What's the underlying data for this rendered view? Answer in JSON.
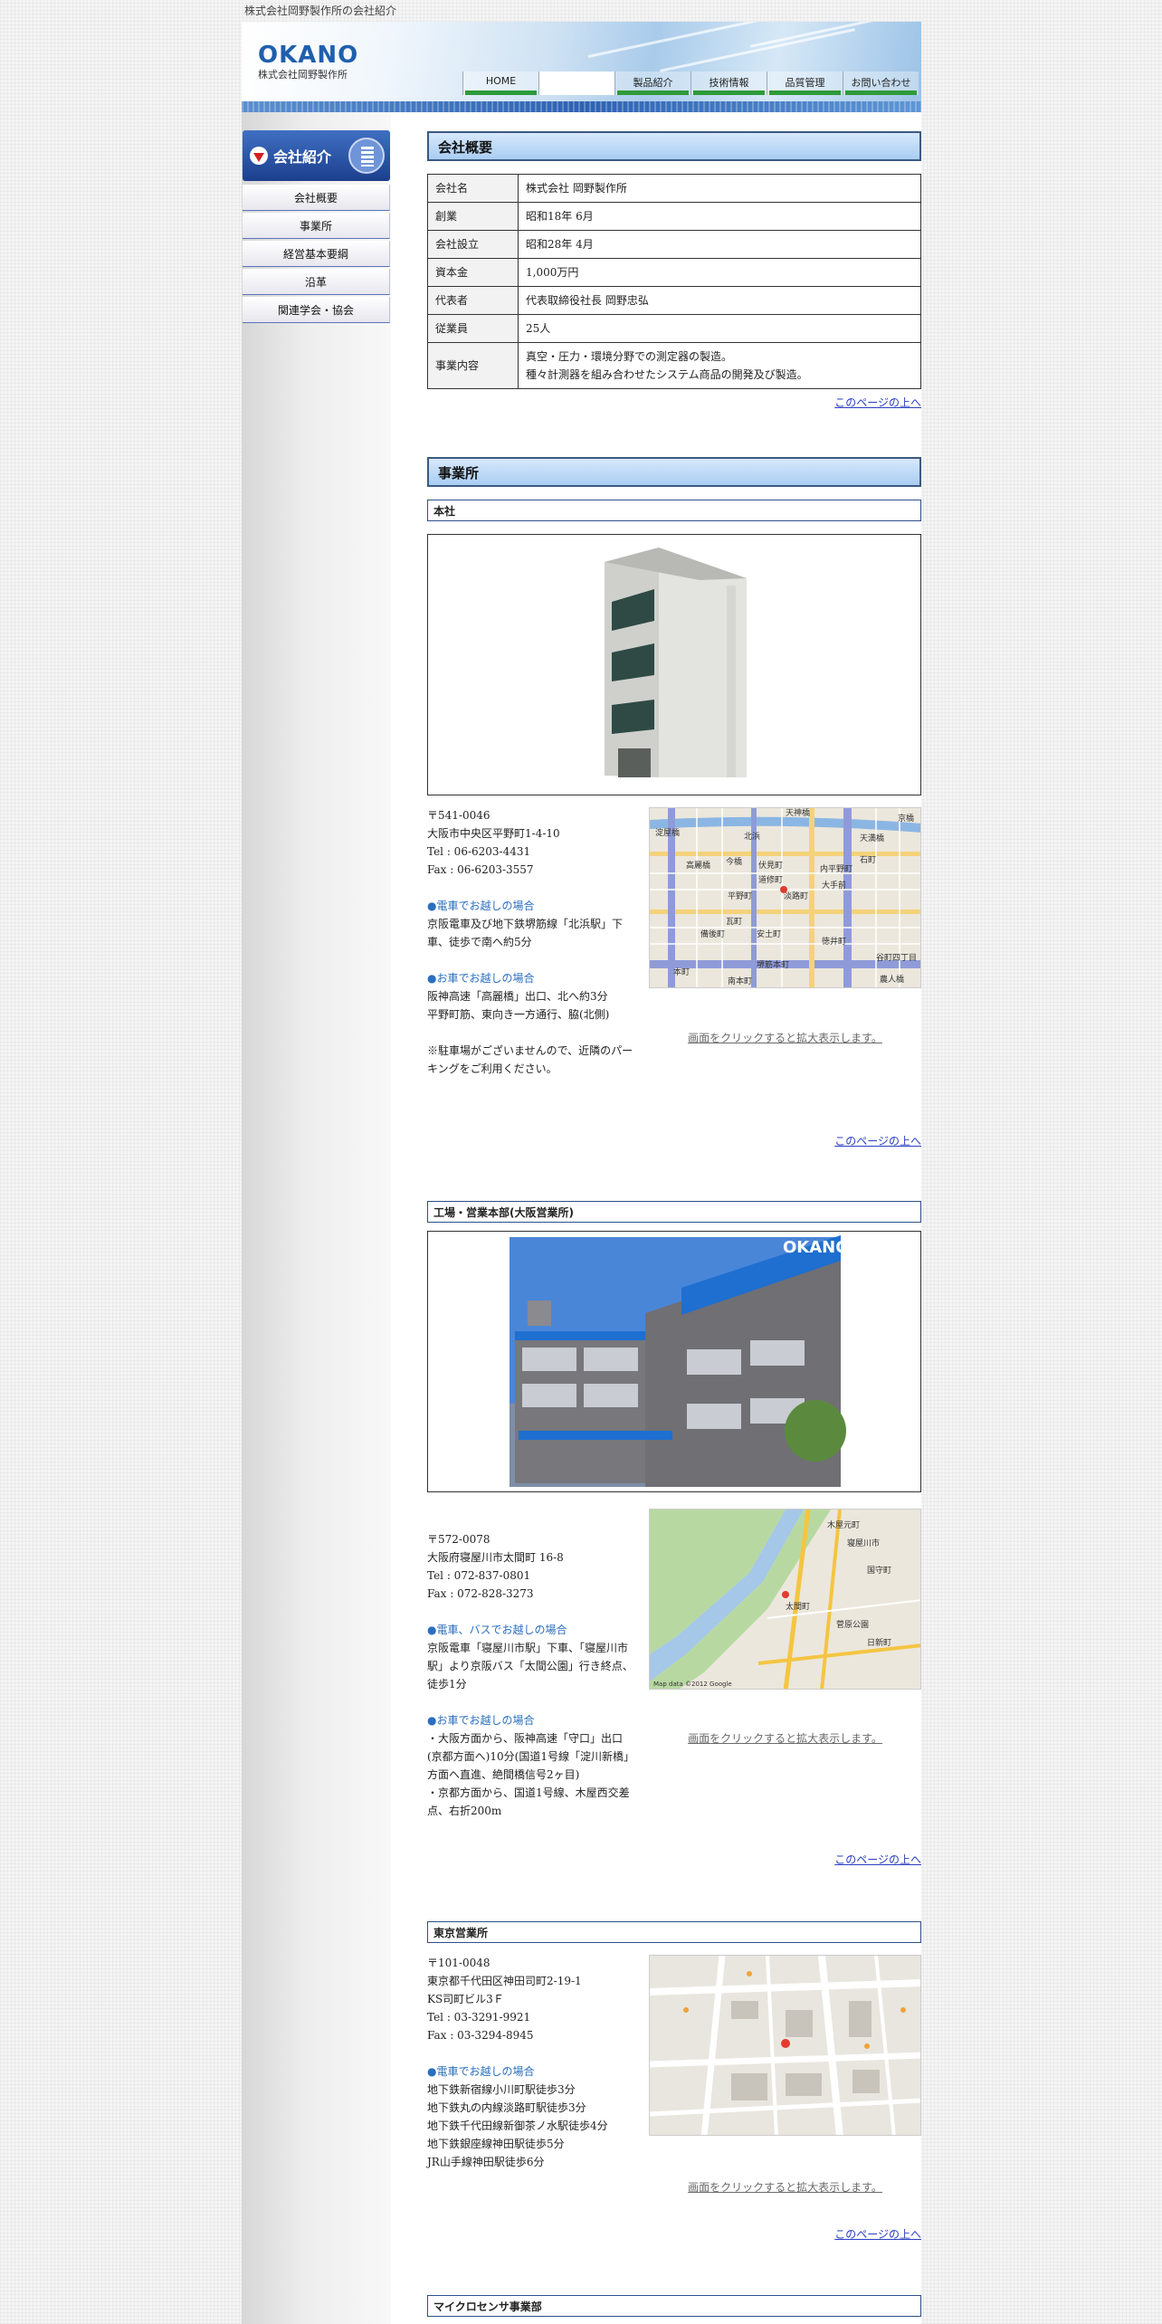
{
  "page": {
    "caption": "株式会社岡野製作所の会社紹介"
  },
  "header": {
    "logo_text": "OKANO",
    "logo_sub": "株式会社岡野製作所",
    "nav": [
      {
        "label": "HOME"
      },
      {
        "label": ""
      },
      {
        "label": "製品紹介"
      },
      {
        "label": "技術情報"
      },
      {
        "label": "品質管理"
      },
      {
        "label": "お問い合わせ"
      }
    ]
  },
  "sidebar": {
    "title": "会社紹介",
    "items": [
      {
        "label": "会社概要"
      },
      {
        "label": "事業所"
      },
      {
        "label": "経営基本要綱"
      },
      {
        "label": "沿革"
      },
      {
        "label": "関連学会・協会"
      }
    ]
  },
  "overview": {
    "title": "会社概要",
    "rows": [
      {
        "key": "会社名",
        "value": "株式会社 岡野製作所"
      },
      {
        "key": "創業",
        "value": "昭和18年 6月"
      },
      {
        "key": "会社設立",
        "value": "昭和28年 4月"
      },
      {
        "key": "資本金",
        "value": "1,000万円"
      },
      {
        "key": "代表者",
        "value": "代表取締役社長 岡野忠弘"
      },
      {
        "key": "従業員",
        "value": "25人"
      },
      {
        "key": "事業内容",
        "value": "真空・圧力・環境分野での測定器の製造。",
        "value2": "種々計測器を組み合わせたシステム商品の開発及び製造。"
      }
    ]
  },
  "to_top": "このページの上へ",
  "offices_title": "事業所",
  "map_link": "画面をクリックすると拡大表示します。",
  "honsha": {
    "title": "本社",
    "postal": "〒541-0046",
    "address": "大阪市中央区平野町1-4-10",
    "tel": "Tel : 06-6203-4431",
    "fax": "Fax : 06-6203-3557",
    "train_heading": "●電車でお越しの場合",
    "train_text": "京阪電車及び地下鉄堺筋線「北浜駅」下車、徒歩で南へ約5分",
    "car_heading": "●お車でお越しの場合",
    "car_text1": "阪神高速「高麗橋」出口、北へ約3分",
    "car_text2": "平野町筋、東向き一方通行、脇(北側)",
    "note": "※駐車場がございませんので、近隣のパーキングをご利用ください。",
    "map_labels": [
      "淀屋橋",
      "北浜",
      "天満橋",
      "今橋",
      "高麗橋",
      "伏見町",
      "道修町",
      "平野町",
      "淡路町",
      "瓦町",
      "備後町",
      "安土町",
      "本町",
      "南本町",
      "内平野町",
      "大手前",
      "徳井町",
      "谷町四丁目",
      "堺筋本町",
      "農人橋",
      "石町",
      "京橋",
      "天神橋"
    ]
  },
  "factory": {
    "title": "工場・営業本部(大阪営業所)",
    "photo_sign": "OKANO",
    "postal": "〒572-0078",
    "address": "大阪府寝屋川市太間町 16-8",
    "tel": "Tel : 072-837-0801",
    "fax": "Fax : 072-828-3273",
    "train_heading": "●電車、バスでお越しの場合",
    "train_text": "京阪電車「寝屋川市駅」下車、「寝屋川市駅」より京阪バス「太間公園」行き終点、徒歩1分",
    "car_heading": "●お車でお越しの場合",
    "car_text1": "・大阪方面から、阪神高速「守口」出口(京都方面へ)10分(国道1号線「淀川新橋」方面へ直進、絶間橋信号2ヶ目)",
    "car_text2": "・京都方面から、国道1号線、木屋西交差点、右折200m",
    "map_labels": [
      "太間町",
      "寝屋川市",
      "国守町",
      "木屋元町",
      "菅原公園",
      "日新町",
      "Map data ©2012 Google"
    ]
  },
  "tokyo": {
    "title": "東京営業所",
    "postal": "〒101-0048",
    "address": "東京都千代田区神田司町2-19-1",
    "building": "KS司町ビル3Ｆ",
    "tel": "Tel : 03-3291-9921",
    "fax": "Fax : 03-3294-8945",
    "train_heading": "●電車でお越しの場合",
    "lines": [
      "地下鉄新宿線小川町駅徒歩3分",
      "地下鉄丸の内線淡路町駅徒歩3分",
      "地下鉄千代田線新御茶ノ水駅徒歩4分",
      "地下鉄銀座線神田駅徒歩5分",
      "JR山手線神田駅徒歩6分"
    ]
  },
  "micro": {
    "title": "マイクロセンサ事業部"
  }
}
